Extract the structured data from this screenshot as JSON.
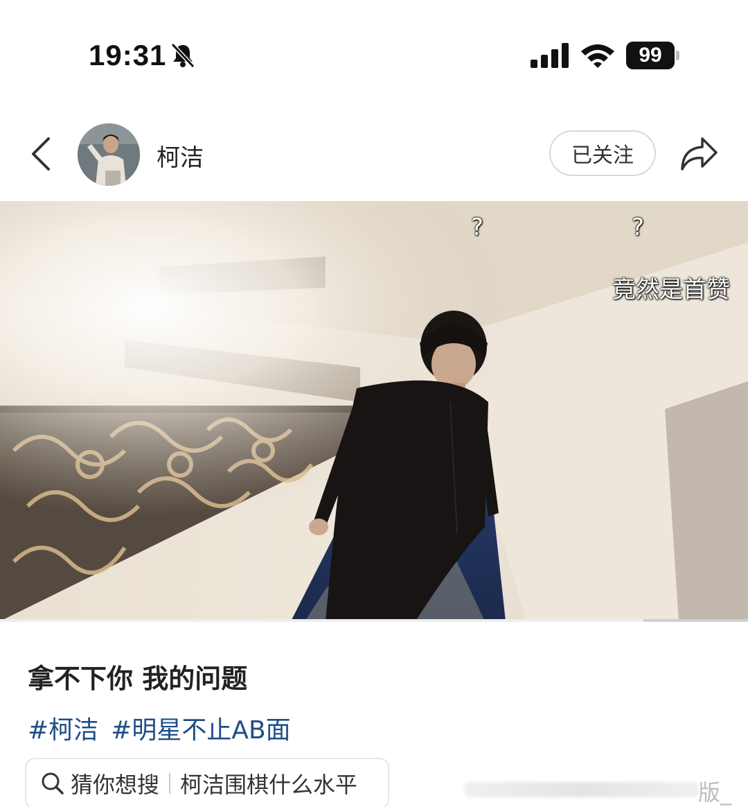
{
  "status_bar": {
    "time": "19:31",
    "battery": "99"
  },
  "header": {
    "user_name": "柯洁",
    "follow_label": "已关注"
  },
  "video": {
    "danmaku": [
      "?",
      "?",
      "竟然是首赞"
    ],
    "progress": 0.86
  },
  "post": {
    "caption": "拿不下你 我的问题",
    "hashtags": [
      "#柯洁",
      "#明星不止AB面"
    ]
  },
  "search": {
    "label": "猜你想搜",
    "query": "柯洁围棋什么水平"
  },
  "watermark": "版_"
}
